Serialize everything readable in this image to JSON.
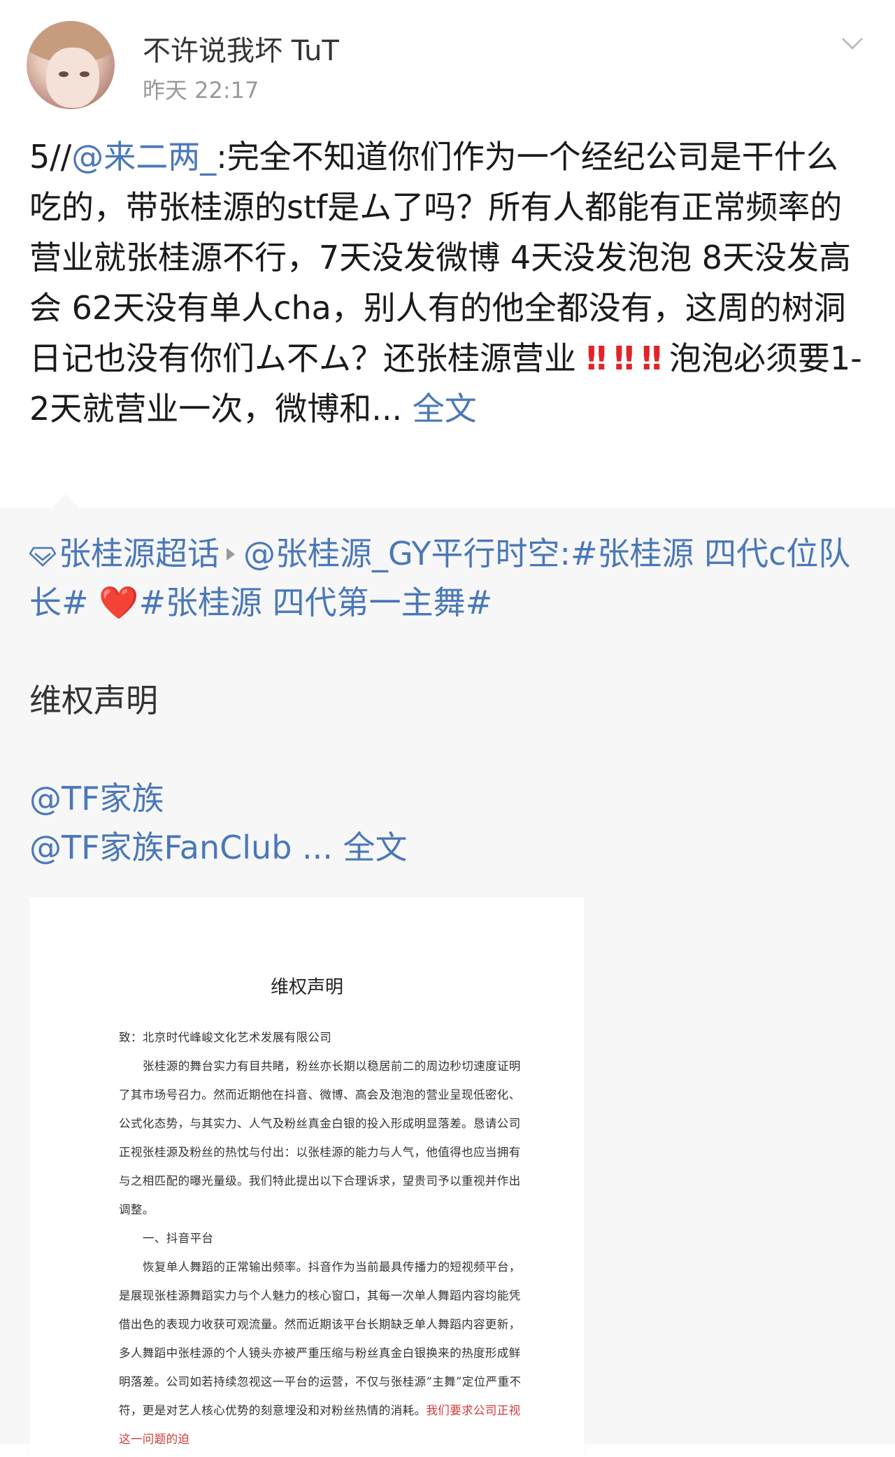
{
  "post": {
    "username": "不许说我坏 TuT",
    "time": "昨天 22:17",
    "text_prefix": "5//",
    "mention": "@来二两_",
    "text_main": ":完全不知道你们作为一个经纪公司是干什么吃的，带张桂源的stf是ム了吗？所有人都能有正常频率的营业就张桂源不行，7天没发微博 4天没发泡泡 8天没发高会 62天没有单人cha，别人有的他全都没有，这周的树洞日记也没有你们ム不ム？还张桂源营业",
    "bangs": [
      "‼",
      "‼",
      "‼"
    ],
    "text_after": "泡泡必须要1-2天就营业一次，微博和...",
    "full_text_link": "全文"
  },
  "repost": {
    "supertopic": "张桂源超话",
    "author": "@张桂源_GY",
    "text_lead": "平行时空:",
    "tag1": "#张桂源 四代c位队长#",
    "heart": "❤️",
    "tag2": "#张桂源 四代第一主舞#",
    "line_title": "维权声明",
    "mention1": "@TF家族",
    "mention2": "@TF家族FanClub",
    "ellipsis": " ... ",
    "full_text_link": "全文"
  },
  "document": {
    "title": "维权声明",
    "salutation": "致：北京时代峰峻文化艺术发展有限公司",
    "para1": "张桂源的舞台实力有目共睹，粉丝亦长期以稳居前二的周边秒切速度证明了其市场号召力。然而近期他在抖音、微博、高会及泡泡的营业呈现低密化、公式化态势，与其实力、人气及粉丝真金白银的投入形成明显落差。恳请公司正视张桂源及粉丝的热忱与付出：以张桂源的能力与人气，他值得也应当拥有与之相匹配的曝光量级。我们特此提出以下合理诉求，望贵司予以重视并作出调整。",
    "section1": "一、抖音平台",
    "para2": "恢复单人舞蹈的正常输出频率。抖音作为当前最具传播力的短视频平台，是展现张桂源舞蹈实力与个人魅力的核心窗口，其每一次单人舞蹈内容均能凭借出色的表现力收获可观流量。然而近期该平台长期缺乏单人舞蹈内容更新，多人舞蹈中张桂源的个人镜头亦被严重压缩与粉丝真金白银换来的热度形成鲜明落差。公司如若持续忽视这一平台的运营，不仅与张桂源“主舞”定位严重不符，更是对艺人核心优势的刻意埋没和对粉丝热情的消耗。",
    "para2_red": "我们要求公司正视这一问题的迫"
  }
}
